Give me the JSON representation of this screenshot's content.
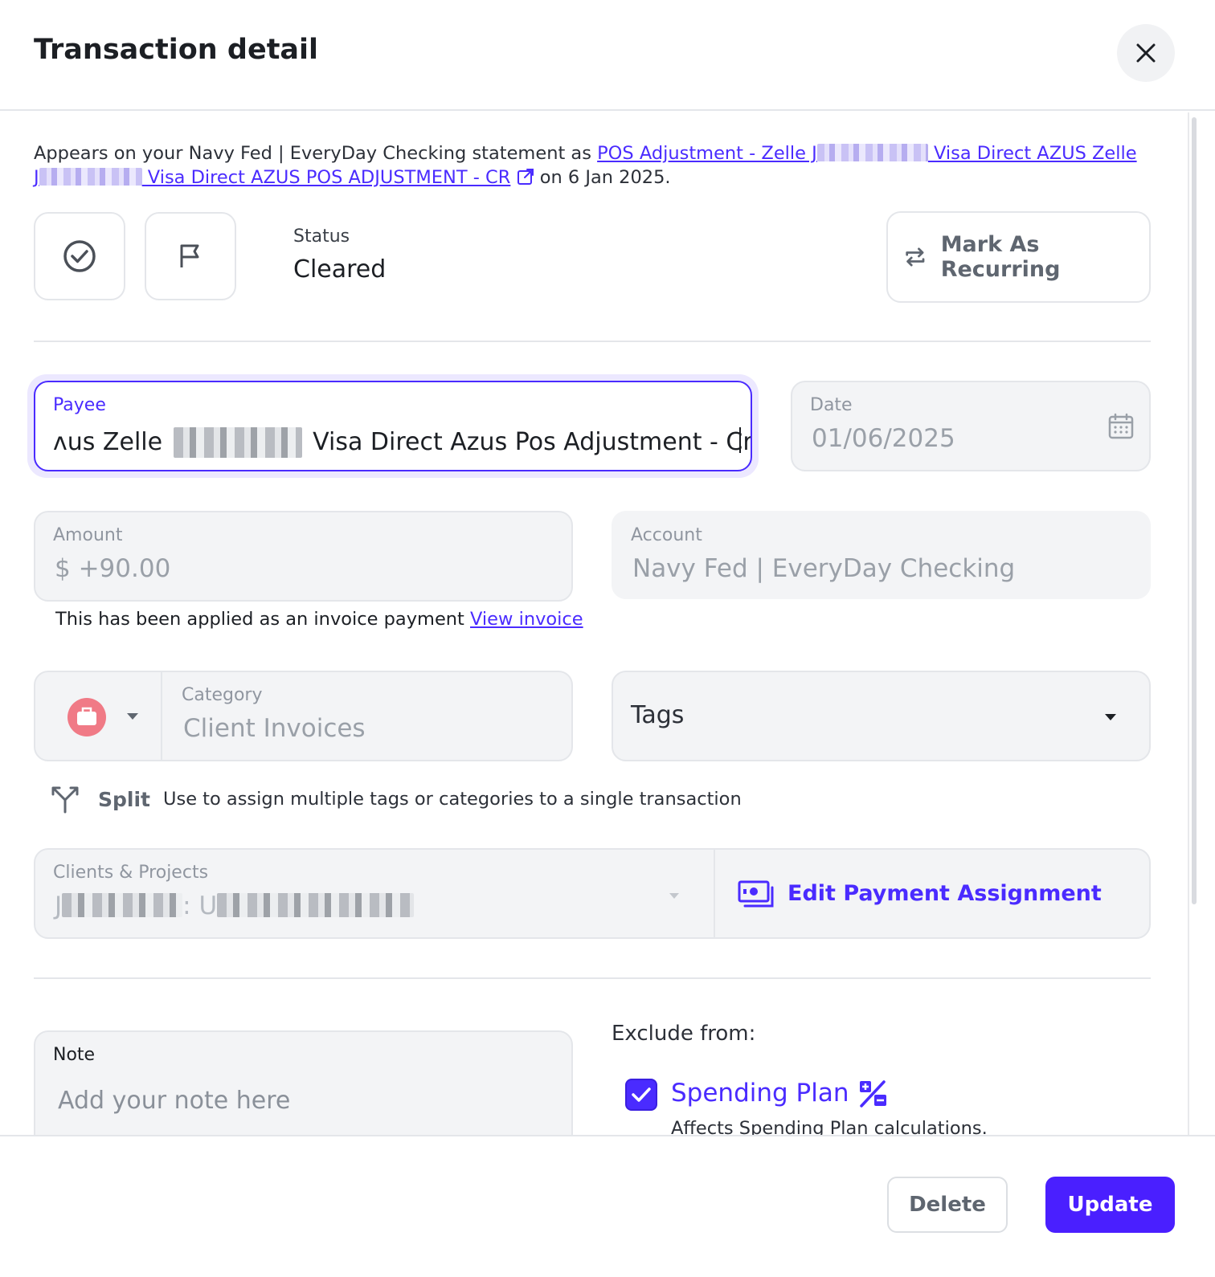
{
  "dialog": {
    "title": "Transaction detail",
    "close_icon": "close-icon"
  },
  "statement": {
    "prefix": "Appears on your Navy Fed | EveryDay Checking statement as",
    "link_part1": "POS Adjustment - Zelle J",
    "link_part2": " Visa Direct AZUS Zelle",
    "link_part3": "J",
    "link_part4": " Visa Direct AZUS POS ADJUSTMENT - CR",
    "suffix": "on 6 Jan 2025.",
    "external_icon": "external-link-icon"
  },
  "status": {
    "label": "Status",
    "value": "Cleared",
    "cleared_icon": "check-circle-icon",
    "flag_icon": "flag-icon"
  },
  "recurring": {
    "label": "Mark As Recurring",
    "icon": "repeat-icon"
  },
  "payee": {
    "label": "Payee",
    "value_start": "ʌus Zelle",
    "value_end": "Visa Direct Azus Pos Adjustment - Cr"
  },
  "date": {
    "label": "Date",
    "value": "01/06/2025",
    "icon": "calendar-icon"
  },
  "amount": {
    "label": "Amount",
    "value": "$ +90.00"
  },
  "account": {
    "label": "Account",
    "value": "Navy Fed | EveryDay Checking"
  },
  "invoice_note": {
    "text": "This has been applied as an invoice payment",
    "link": "View invoice"
  },
  "category": {
    "label": "Category",
    "value": "Client Invoices",
    "icon": "briefcase-icon",
    "icon_color": "#f07a86"
  },
  "tags": {
    "label": "Tags"
  },
  "split": {
    "label": "Split",
    "description": "Use to assign multiple tags or categories to a single transaction",
    "icon": "split-icon"
  },
  "clients_projects": {
    "label": "Clients & Projects",
    "value_start": "J",
    "value_mid": ": U"
  },
  "payment_assignment": {
    "label": "Edit Payment Assignment",
    "icon": "money-icon"
  },
  "note": {
    "label": "Note",
    "placeholder": "Add your note here"
  },
  "exclude": {
    "title": "Exclude from:",
    "spending_plan_label": "Spending Plan",
    "spending_plan_checked": true,
    "spending_plan_desc": "Affects Spending Plan calculations.",
    "spending_icon": "percent-plus-minus-icon"
  },
  "footer": {
    "delete_label": "Delete",
    "update_label": "Update"
  },
  "colors": {
    "accent": "#4a2bff",
    "field_bg": "#f3f4f6",
    "border": "#e4e6ea"
  }
}
